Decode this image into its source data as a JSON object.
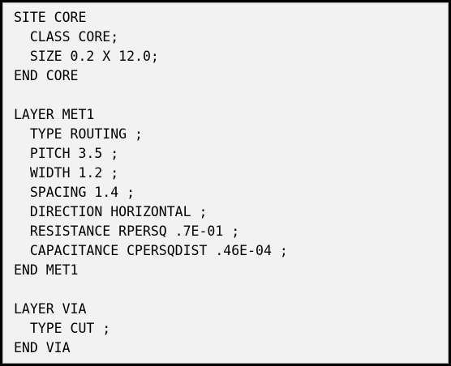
{
  "code": {
    "lines": [
      "SITE CORE",
      "  CLASS CORE;",
      "  SIZE 0.2 X 12.0;",
      "END CORE",
      "",
      "LAYER MET1",
      "  TYPE ROUTING ;",
      "  PITCH 3.5 ;",
      "  WIDTH 1.2 ;",
      "  SPACING 1.4 ;",
      "  DIRECTION HORIZONTAL ;",
      "  RESISTANCE RPERSQ .7E-01 ;",
      "  CAPACITANCE CPERSQDIST .46E-04 ;",
      "END MET1",
      "",
      "LAYER VIA",
      "  TYPE CUT ;",
      "END VIA"
    ]
  },
  "colors": {
    "background": "#f2f2f2",
    "border": "#000000",
    "text": "#000000"
  }
}
